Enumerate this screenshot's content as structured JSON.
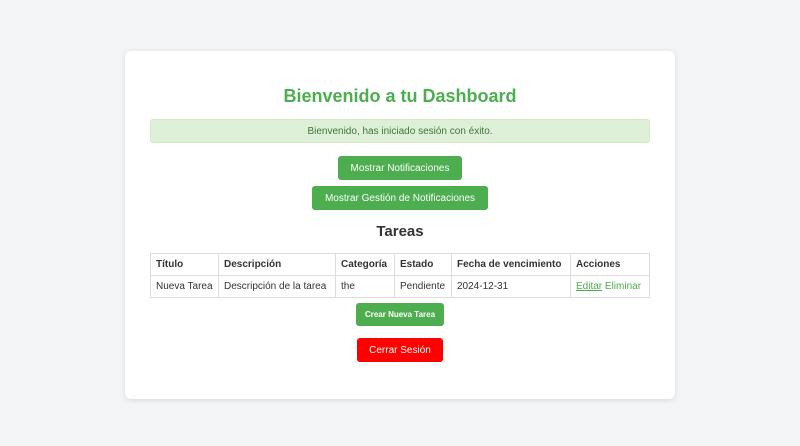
{
  "page": {
    "title": "Bienvenido a tu Dashboard",
    "alert": "Bienvenido, has iniciado sesión con éxito."
  },
  "buttons": {
    "show_notifications": "Mostrar Notificaciones",
    "show_notification_management": "Mostrar Gestión de Notificaciones",
    "create_task": "Crear Nueva Tarea",
    "logout": "Cerrar Sesión"
  },
  "tasks": {
    "heading": "Tareas",
    "columns": [
      "Título",
      "Descripción",
      "Categoría",
      "Estado",
      "Fecha de vencimiento",
      "Acciones"
    ],
    "rows": [
      {
        "title": "Nueva Tarea",
        "description": "Descripción de la tarea",
        "category": "the",
        "status": "Pendiente",
        "due_date": "2024-12-31",
        "edit_label": "Editar",
        "delete_label": "Eliminar"
      }
    ]
  },
  "colors": {
    "accent": "#4cae4f",
    "danger": "#ff0000",
    "alert_bg": "#dff0d8",
    "alert_text": "#3c763d"
  }
}
